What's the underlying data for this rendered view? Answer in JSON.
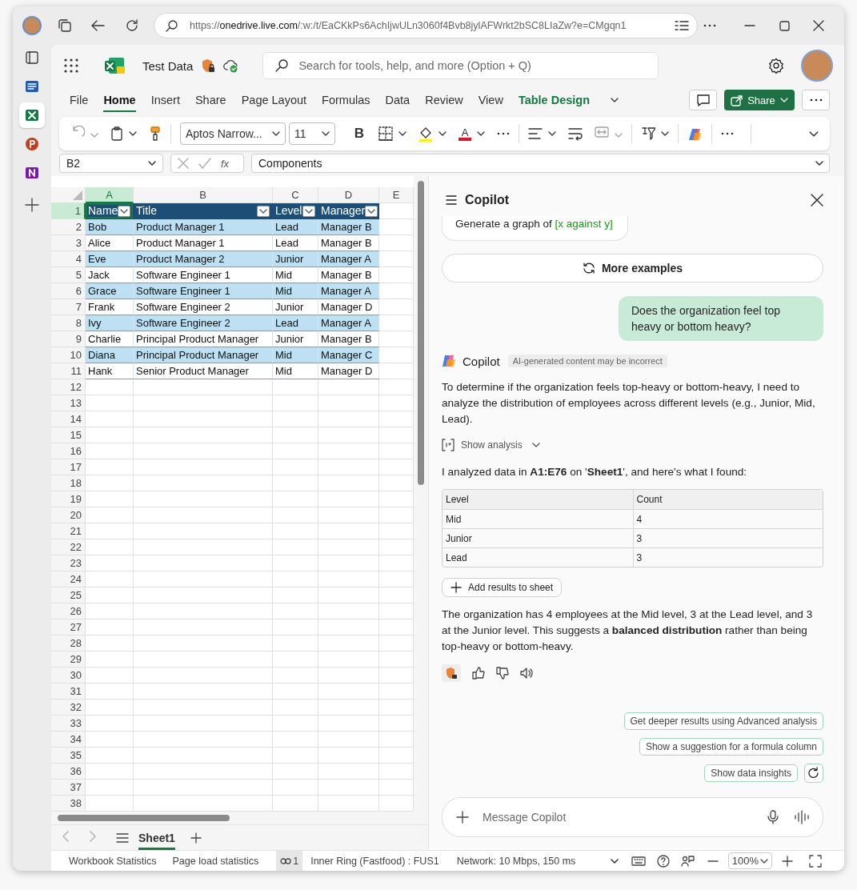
{
  "browser": {
    "url": {
      "scheme": "https://",
      "host": "onedrive.live.com",
      "path": "/:w:/t/EaCKkPs6AchIjwULn3060f4Bvb8jylAFWrkt2bSC8LIaZw?e=CMgqn1"
    }
  },
  "app_rail": [
    {
      "kind": "panel",
      "selected": false
    },
    {
      "kind": "document",
      "selected": false
    },
    {
      "kind": "spreadsheet",
      "selected": true
    },
    {
      "kind": "presentation",
      "selected": false
    },
    {
      "kind": "notebook",
      "selected": false
    },
    {
      "kind": "add",
      "selected": false
    }
  ],
  "header": {
    "document_title": "Test Data",
    "search": {
      "placeholder": "Search for tools, help, and more (Option + Q)"
    }
  },
  "menu_tabs": [
    {
      "label": "File",
      "selected": false,
      "contextual": false
    },
    {
      "label": "Home",
      "selected": true,
      "contextual": false
    },
    {
      "label": "Insert",
      "selected": false,
      "contextual": false
    },
    {
      "label": "Share",
      "selected": false,
      "contextual": false
    },
    {
      "label": "Page Layout",
      "selected": false,
      "contextual": false
    },
    {
      "label": "Formulas",
      "selected": false,
      "contextual": false
    },
    {
      "label": "Data",
      "selected": false,
      "contextual": false
    },
    {
      "label": "Review",
      "selected": false,
      "contextual": false
    },
    {
      "label": "View",
      "selected": false,
      "contextual": false
    },
    {
      "label": "Table Design",
      "selected": false,
      "contextual": true
    }
  ],
  "share_button": "Share",
  "ribbon": {
    "font_name": "Aptos Narrow...",
    "font_size": "11",
    "bold_label": "B",
    "font_color_label": "A"
  },
  "formula_bar": {
    "name_box": "B2",
    "function_label": "fx",
    "value": "Components"
  },
  "sheet": {
    "columns": [
      {
        "label": "A",
        "selected": true
      },
      {
        "label": "B",
        "selected": false
      },
      {
        "label": "C",
        "selected": false
      },
      {
        "label": "D",
        "selected": false
      },
      {
        "label": "E",
        "selected": false
      }
    ],
    "row_numbers": [
      {
        "label": "1",
        "selected": true
      },
      {
        "label": "2",
        "selected": false
      },
      {
        "label": "3",
        "selected": false
      },
      {
        "label": "4",
        "selected": false
      },
      {
        "label": "5",
        "selected": false
      },
      {
        "label": "6",
        "selected": false
      },
      {
        "label": "7",
        "selected": false
      },
      {
        "label": "8",
        "selected": false
      },
      {
        "label": "9",
        "selected": false
      },
      {
        "label": "10",
        "selected": false
      },
      {
        "label": "11",
        "selected": false
      },
      {
        "label": "12",
        "selected": false
      },
      {
        "label": "13",
        "selected": false
      },
      {
        "label": "14",
        "selected": false
      },
      {
        "label": "15",
        "selected": false
      },
      {
        "label": "16",
        "selected": false
      },
      {
        "label": "17",
        "selected": false
      },
      {
        "label": "18",
        "selected": false
      },
      {
        "label": "19",
        "selected": false
      },
      {
        "label": "20",
        "selected": false
      },
      {
        "label": "21",
        "selected": false
      },
      {
        "label": "22",
        "selected": false
      },
      {
        "label": "23",
        "selected": false
      },
      {
        "label": "24",
        "selected": false
      },
      {
        "label": "25",
        "selected": false
      },
      {
        "label": "26",
        "selected": false
      },
      {
        "label": "27",
        "selected": false
      },
      {
        "label": "28",
        "selected": false
      },
      {
        "label": "29",
        "selected": false
      },
      {
        "label": "30",
        "selected": false
      },
      {
        "label": "31",
        "selected": false
      },
      {
        "label": "32",
        "selected": false
      },
      {
        "label": "33",
        "selected": false
      },
      {
        "label": "34",
        "selected": false
      },
      {
        "label": "35",
        "selected": false
      },
      {
        "label": "36",
        "selected": false
      },
      {
        "label": "37",
        "selected": false
      },
      {
        "label": "38",
        "selected": false
      }
    ],
    "table": {
      "headers": [
        "Name",
        "Title",
        "Level",
        "Manager"
      ],
      "rows": [
        [
          "Bob",
          "Product Manager 1",
          "Lead",
          "Manager B"
        ],
        [
          "Alice",
          "Product Manager 1",
          "Lead",
          "Manager B"
        ],
        [
          "Eve",
          "Product Manager 2",
          "Junior",
          "Manager A"
        ],
        [
          "Jack",
          "Software Engineer 1",
          "Mid",
          "Manager B"
        ],
        [
          "Grace",
          "Software Engineer 1",
          "Mid",
          "Manager A"
        ],
        [
          "Frank",
          "Software Engineer 2",
          "Junior",
          "Manager D"
        ],
        [
          "Ivy",
          "Software Engineer 2",
          "Lead",
          "Manager A"
        ],
        [
          "Charlie",
          "Principal Product Manager",
          "Junior",
          "Manager B"
        ],
        [
          "Diana",
          "Principal Product Manager",
          "Mid",
          "Manager C"
        ],
        [
          "Hank",
          "Senior Product Manager",
          "Mid",
          "Manager D"
        ]
      ]
    }
  },
  "sheet_tabs": [
    {
      "label": "Sheet1",
      "selected": true
    }
  ],
  "copilot": {
    "title": "Copilot",
    "example_prompt": {
      "text": "Generate a graph of",
      "variable": "[x against y]"
    },
    "more_examples": "More examples",
    "user_message": "Does the organization feel top heavy or bottom heavy?",
    "response": {
      "author": "Copilot",
      "disclaimer": "AI-generated content may be incorrect",
      "intro": "To determine if the organization feels top-heavy or bottom-heavy, I need to analyze the distribution of employees across different levels (e.g., Junior, Mid, Lead).",
      "show_analysis": "Show analysis",
      "found": "I analyzed data in **A1:E76** on '**Sheet1**', and here's what I found:",
      "result_table": {
        "columns": [
          "Level",
          "Count"
        ],
        "rows": [
          [
            "Mid",
            "4"
          ],
          [
            "Junior",
            "3"
          ],
          [
            "Lead",
            "3"
          ]
        ]
      },
      "add_results": "Add results to sheet",
      "summary": "The organization has 4 employees at the Mid level, 3 at the Lead level, and 3 at the Junior level. This suggests a **balanced distribution** rather than being top-heavy or bottom-heavy."
    },
    "suggestions": [
      "Get deeper results using Advanced analysis",
      "Show a suggestion for a formula column",
      "Show data insights"
    ],
    "composer": {
      "placeholder": "Message Copilot"
    }
  },
  "status_bar": {
    "items": [
      "Workbook Statistics",
      "Page load statistics"
    ],
    "coauthors": "1",
    "ring": "Inner Ring (Fastfood) : FUS1",
    "network": "Network: 10 Mbps, 150 ms",
    "zoom": "100%"
  }
}
